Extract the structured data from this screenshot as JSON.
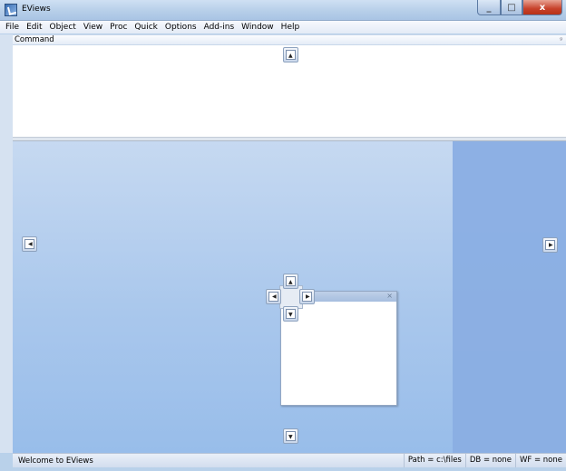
{
  "window": {
    "title": "EViews",
    "buttons": {
      "minimize": "_",
      "maximize": "□",
      "close": "x"
    }
  },
  "menu": [
    "File",
    "Edit",
    "Object",
    "View",
    "Proc",
    "Quick",
    "Options",
    "Add-ins",
    "Window",
    "Help"
  ],
  "command": {
    "title": "Command",
    "pin": "ᵍ"
  },
  "floating_window": {
    "close": "×"
  },
  "status": {
    "message": "Welcome to EViews",
    "path": "Path = c:\\files",
    "db": "DB = none",
    "wf": "WF = none"
  },
  "colors": {
    "accent": "#8aaee3",
    "workspace": "#a9c7ec",
    "close_button": "#c7412a"
  }
}
